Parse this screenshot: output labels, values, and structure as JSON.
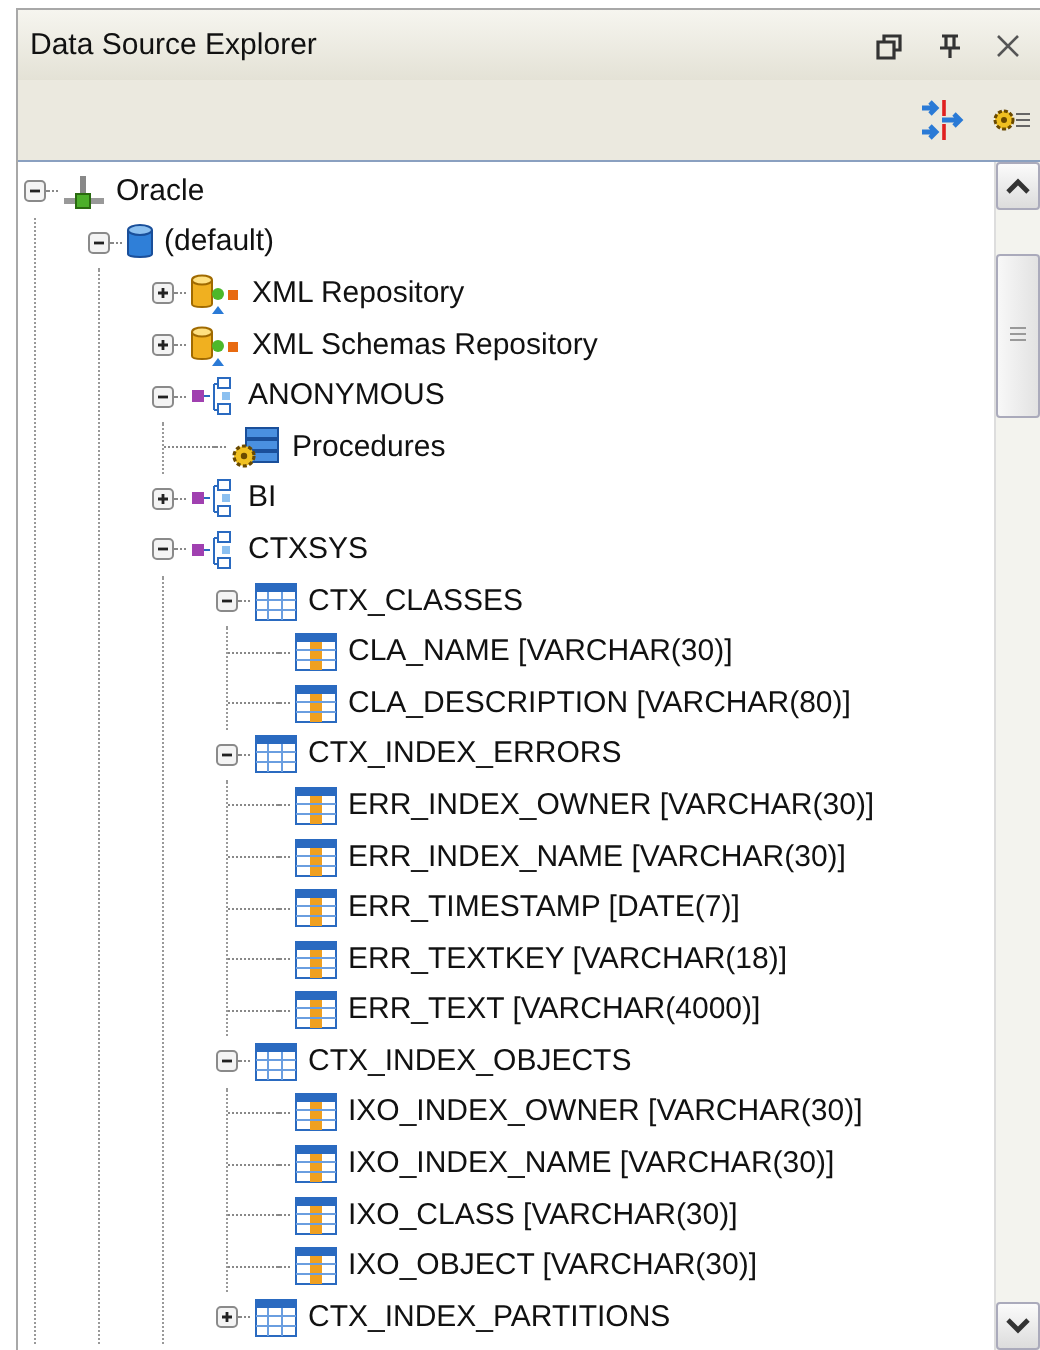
{
  "panel": {
    "title": "Data Source Explorer"
  },
  "tree": [
    {
      "label": "Oracle",
      "kind": "connection",
      "expanded": true,
      "children": [
        {
          "label": "(default)",
          "kind": "database",
          "expanded": true,
          "children": [
            {
              "label": "XML Repository",
              "kind": "repository",
              "expanded": false
            },
            {
              "label": "XML Schemas Repository",
              "kind": "repository",
              "expanded": false
            },
            {
              "label": "ANONYMOUS",
              "kind": "schema",
              "expanded": true,
              "children": [
                {
                  "label": "Procedures",
                  "kind": "procedures"
                }
              ]
            },
            {
              "label": "BI",
              "kind": "schema",
              "expanded": false
            },
            {
              "label": "CTXSYS",
              "kind": "schema",
              "expanded": true,
              "children": [
                {
                  "label": "CTX_CLASSES",
                  "kind": "table",
                  "expanded": true,
                  "children": [
                    {
                      "label": "CLA_NAME [VARCHAR(30)]",
                      "kind": "column"
                    },
                    {
                      "label": "CLA_DESCRIPTION [VARCHAR(80)]",
                      "kind": "column"
                    }
                  ]
                },
                {
                  "label": "CTX_INDEX_ERRORS",
                  "kind": "table",
                  "expanded": true,
                  "children": [
                    {
                      "label": "ERR_INDEX_OWNER [VARCHAR(30)]",
                      "kind": "column"
                    },
                    {
                      "label": "ERR_INDEX_NAME [VARCHAR(30)]",
                      "kind": "column"
                    },
                    {
                      "label": "ERR_TIMESTAMP [DATE(7)]",
                      "kind": "column"
                    },
                    {
                      "label": "ERR_TEXTKEY [VARCHAR(18)]",
                      "kind": "column"
                    },
                    {
                      "label": "ERR_TEXT [VARCHAR(4000)]",
                      "kind": "column"
                    }
                  ]
                },
                {
                  "label": "CTX_INDEX_OBJECTS",
                  "kind": "table",
                  "expanded": true,
                  "children": [
                    {
                      "label": "IXO_INDEX_OWNER [VARCHAR(30)]",
                      "kind": "column"
                    },
                    {
                      "label": "IXO_INDEX_NAME [VARCHAR(30)]",
                      "kind": "column"
                    },
                    {
                      "label": "IXO_CLASS [VARCHAR(30)]",
                      "kind": "column"
                    },
                    {
                      "label": "IXO_OBJECT [VARCHAR(30)]",
                      "kind": "column"
                    }
                  ]
                },
                {
                  "label": "CTX_INDEX_PARTITIONS",
                  "kind": "table",
                  "expanded": false
                }
              ]
            }
          ]
        }
      ]
    }
  ]
}
